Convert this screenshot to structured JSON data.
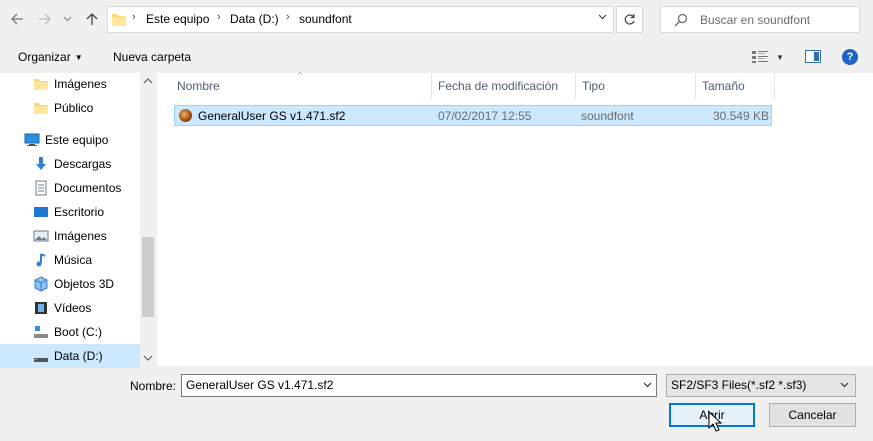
{
  "address": {
    "crumbs": [
      "Este equipo",
      "Data (D:)",
      "soundfont"
    ]
  },
  "search": {
    "placeholder": "Buscar en soundfont"
  },
  "toolbar": {
    "organize": "Organizar",
    "new_folder": "Nueva carpeta"
  },
  "nav": {
    "items": [
      {
        "label": "Imágenes",
        "icon": "folder-icon"
      },
      {
        "label": "Público",
        "icon": "folder-icon"
      },
      {
        "label": "Este equipo",
        "icon": "computer-icon"
      },
      {
        "label": "Descargas",
        "icon": "download-icon"
      },
      {
        "label": "Documentos",
        "icon": "documents-icon"
      },
      {
        "label": "Escritorio",
        "icon": "desktop-icon"
      },
      {
        "label": "Imágenes",
        "icon": "pictures-icon"
      },
      {
        "label": "Música",
        "icon": "music-icon"
      },
      {
        "label": "Objetos 3D",
        "icon": "objects-3d-icon"
      },
      {
        "label": "Vídeos",
        "icon": "videos-icon"
      },
      {
        "label": "Boot (C:)",
        "icon": "drive-icon"
      },
      {
        "label": "Data (D:)",
        "icon": "drive-icon"
      }
    ]
  },
  "columns": {
    "name": "Nombre",
    "modified": "Fecha de modificación",
    "type": "Tipo",
    "size": "Tamaño"
  },
  "files": [
    {
      "name": "GeneralUser GS v1.471.sf2",
      "modified": "07/02/2017 12:55",
      "type": "soundfont",
      "size": "30.549 KB"
    }
  ],
  "footer": {
    "name_label": "Nombre:",
    "name_value": "GeneralUser GS v1.471.sf2",
    "filter": "SF2/SF3 Files(*.sf2 *.sf3)",
    "open": "Abrir",
    "cancel": "Cancelar"
  },
  "colors": {
    "selection": "#cce8ff",
    "selection_border": "#99d1ff",
    "accent": "#0078d7"
  }
}
